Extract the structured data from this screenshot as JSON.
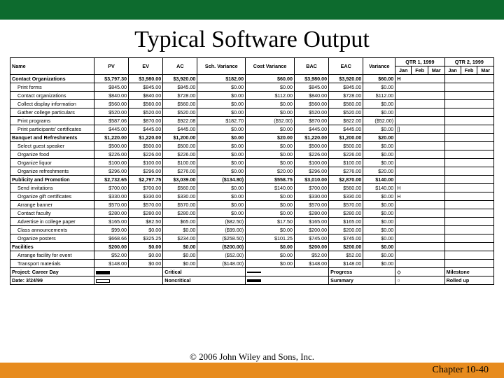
{
  "title": "Typical Software Output",
  "copyright": "© 2006 John Wiley and Sons, Inc.",
  "chapter": "Chapter 10-40",
  "headers": {
    "name": "Name",
    "pv": "PV",
    "ev": "EV",
    "ac": "AC",
    "sv": "Sch. Variance",
    "cv": "Cost Variance",
    "bac": "BAC",
    "eac": "EAC",
    "var": "Variance",
    "q1": "QTR 1, 1999",
    "q2": "QTR 2, 1999",
    "m_jan": "Jan",
    "m_feb": "Feb",
    "m_mar": "Mar"
  },
  "rows": [
    {
      "bold": 1,
      "name": "Contact Organizations",
      "pv": "$3,797.30",
      "ev": "$3,980.00",
      "ac": "$3,920.00",
      "sv": "$182.00",
      "cv": "$60.00",
      "bac": "$3,980.00",
      "eac": "$3,920.00",
      "var": "$60.00",
      "g1": "H",
      "g2": ""
    },
    {
      "indent": 1,
      "name": "Print forms",
      "pv": "$845.00",
      "ev": "$845.00",
      "ac": "$845.00",
      "sv": "$0.00",
      "cv": "$0.00",
      "bac": "$845.00",
      "eac": "$845.00",
      "var": "$0.00",
      "g1": "",
      "g2": ""
    },
    {
      "indent": 1,
      "name": "Contact organizations",
      "pv": "$840.00",
      "ev": "$840.00",
      "ac": "$728.00",
      "sv": "$0.00",
      "cv": "$112.00",
      "bac": "$840.00",
      "eac": "$728.00",
      "var": "$112.00",
      "g1": "",
      "g2": ""
    },
    {
      "indent": 1,
      "name": "Collect display information",
      "pv": "$560.00",
      "ev": "$560.00",
      "ac": "$560.00",
      "sv": "$0.00",
      "cv": "$0.00",
      "bac": "$560.00",
      "eac": "$560.00",
      "var": "$0.00",
      "g1": "",
      "g2": ""
    },
    {
      "indent": 1,
      "name": "Gather college particulars",
      "pv": "$520.00",
      "ev": "$520.00",
      "ac": "$520.00",
      "sv": "$0.00",
      "cv": "$0.00",
      "bac": "$520.00",
      "eac": "$520.00",
      "var": "$0.00",
      "g1": "",
      "g2": ""
    },
    {
      "indent": 1,
      "name": "Print programs",
      "pv": "$587.06",
      "ev": "$870.00",
      "ac": "$922.08",
      "sv": "$182.70",
      "cv": "($52.00)",
      "bac": "$870.00",
      "eac": "$822.00",
      "var": "($52.00)",
      "g1": "",
      "g2": ""
    },
    {
      "indent": 1,
      "name": "Print participants' certificates",
      "pv": "$445.00",
      "ev": "$445.00",
      "ac": "$445.00",
      "sv": "$0.00",
      "cv": "$0.00",
      "bac": "$445.00",
      "eac": "$445.00",
      "var": "$0.00",
      "g1": "[]",
      "g2": ""
    },
    {
      "bold": 1,
      "name": "Banquet and Refreshments",
      "pv": "$1,220.00",
      "ev": "$1,220.00",
      "ac": "$1,200.00",
      "sv": "$0.00",
      "cv": "$20.00",
      "bac": "$1,220.00",
      "eac": "$1,200.00",
      "var": "$20.00",
      "g1": "",
      "g2": ""
    },
    {
      "indent": 1,
      "name": "Select guest speaker",
      "pv": "$500.00",
      "ev": "$500.00",
      "ac": "$500.00",
      "sv": "$0.00",
      "cv": "$0.00",
      "bac": "$500.00",
      "eac": "$500.00",
      "var": "$0.00",
      "g1": "",
      "g2": ""
    },
    {
      "indent": 1,
      "name": "Organize food",
      "pv": "$226.00",
      "ev": "$226.00",
      "ac": "$226.00",
      "sv": "$0.00",
      "cv": "$0.00",
      "bac": "$226.00",
      "eac": "$226.00",
      "var": "$0.00",
      "g1": "",
      "g2": ""
    },
    {
      "indent": 1,
      "name": "Organize liquor",
      "pv": "$100.00",
      "ev": "$100.00",
      "ac": "$100.00",
      "sv": "$0.00",
      "cv": "$0.00",
      "bac": "$100.00",
      "eac": "$100.00",
      "var": "$0.00",
      "g1": "",
      "g2": ""
    },
    {
      "indent": 1,
      "name": "Organize refreshments",
      "pv": "$296.00",
      "ev": "$296.00",
      "ac": "$276.00",
      "sv": "$0.00",
      "cv": "$20.00",
      "bac": "$296.00",
      "eac": "$276.00",
      "var": "$20.00",
      "g1": "",
      "g2": ""
    },
    {
      "bold": 1,
      "name": "Publicity and Promotion",
      "pv": "$2,732.65",
      "ev": "$2,797.75",
      "ac": "$3,039.00",
      "sv": "($134.80)",
      "cv": "$558.75",
      "bac": "$3,010.00",
      "eac": "$2,870.00",
      "var": "$140.00",
      "g1": "",
      "g2": ""
    },
    {
      "indent": 1,
      "name": "Send invitations",
      "pv": "$700.00",
      "ev": "$700.00",
      "ac": "$560.00",
      "sv": "$0.00",
      "cv": "$140.00",
      "bac": "$700.00",
      "eac": "$560.00",
      "var": "$140.00",
      "g1": "H",
      "g2": ""
    },
    {
      "indent": 1,
      "name": "Organize gift certificates",
      "pv": "$330.00",
      "ev": "$330.00",
      "ac": "$330.00",
      "sv": "$0.00",
      "cv": "$0.00",
      "bac": "$330.00",
      "eac": "$330.00",
      "var": "$0.00",
      "g1": "H",
      "g2": ""
    },
    {
      "indent": 1,
      "name": "Arrange banner",
      "pv": "$570.00",
      "ev": "$570.00",
      "ac": "$570.00",
      "sv": "$0.00",
      "cv": "$0.00",
      "bac": "$570.00",
      "eac": "$570.00",
      "var": "$0.00",
      "g1": "",
      "g2": ""
    },
    {
      "indent": 1,
      "name": "Contact faculty",
      "pv": "$280.00",
      "ev": "$280.00",
      "ac": "$280.00",
      "sv": "$0.00",
      "cv": "$0.00",
      "bac": "$280.00",
      "eac": "$280.00",
      "var": "$0.00",
      "g1": "",
      "g2": ""
    },
    {
      "indent": 1,
      "name": "Advertise in college paper",
      "pv": "$165.00",
      "ev": "$82.50",
      "ac": "$65.00",
      "sv": "($82.50)",
      "cv": "$17.50",
      "bac": "$165.00",
      "eac": "$165.00",
      "var": "$0.00",
      "g1": "",
      "g2": ""
    },
    {
      "indent": 1,
      "name": "Class announcements",
      "pv": "$99.00",
      "ev": "$0.00",
      "ac": "$0.00",
      "sv": "($99.00)",
      "cv": "$0.00",
      "bac": "$200.00",
      "eac": "$200.00",
      "var": "$0.00",
      "g1": "",
      "g2": ""
    },
    {
      "indent": 1,
      "name": "Organize posters",
      "pv": "$668.66",
      "ev": "$325.25",
      "ac": "$234.00",
      "sv": "($258.50)",
      "cv": "$101.25",
      "bac": "$745.00",
      "eac": "$745.00",
      "var": "$0.00",
      "g1": "",
      "g2": ""
    },
    {
      "bold": 1,
      "name": "Facilities",
      "pv": "$200.00",
      "ev": "$0.00",
      "ac": "$0.00",
      "sv": "($200.00)",
      "cv": "$0.00",
      "bac": "$200.00",
      "eac": "$200.00",
      "var": "$0.00",
      "g1": "",
      "g2": ""
    },
    {
      "indent": 1,
      "name": "Arrange facility for event",
      "pv": "$52.00",
      "ev": "$0.00",
      "ac": "$0.00",
      "sv": "($52.00)",
      "cv": "$0.00",
      "bac": "$52.00",
      "eac": "$52.00",
      "var": "$0.00",
      "g1": "",
      "g2": ""
    },
    {
      "indent": 1,
      "name": "Transport materials",
      "pv": "$148.00",
      "ev": "$0.00",
      "ac": "$0.00",
      "sv": "($148.00)",
      "cv": "$0.00",
      "bac": "$148.00",
      "eac": "$148.00",
      "var": "$0.00",
      "g1": "",
      "g2": ""
    }
  ],
  "footer_info": {
    "project_line1": "Project: Career Day",
    "project_line2": "Date: 3/24/99",
    "l1": "Critical",
    "l2": "Noncritical",
    "l3": "Progress",
    "l4": "Summary",
    "l5": "Milestone",
    "l6": "Rolled up"
  }
}
